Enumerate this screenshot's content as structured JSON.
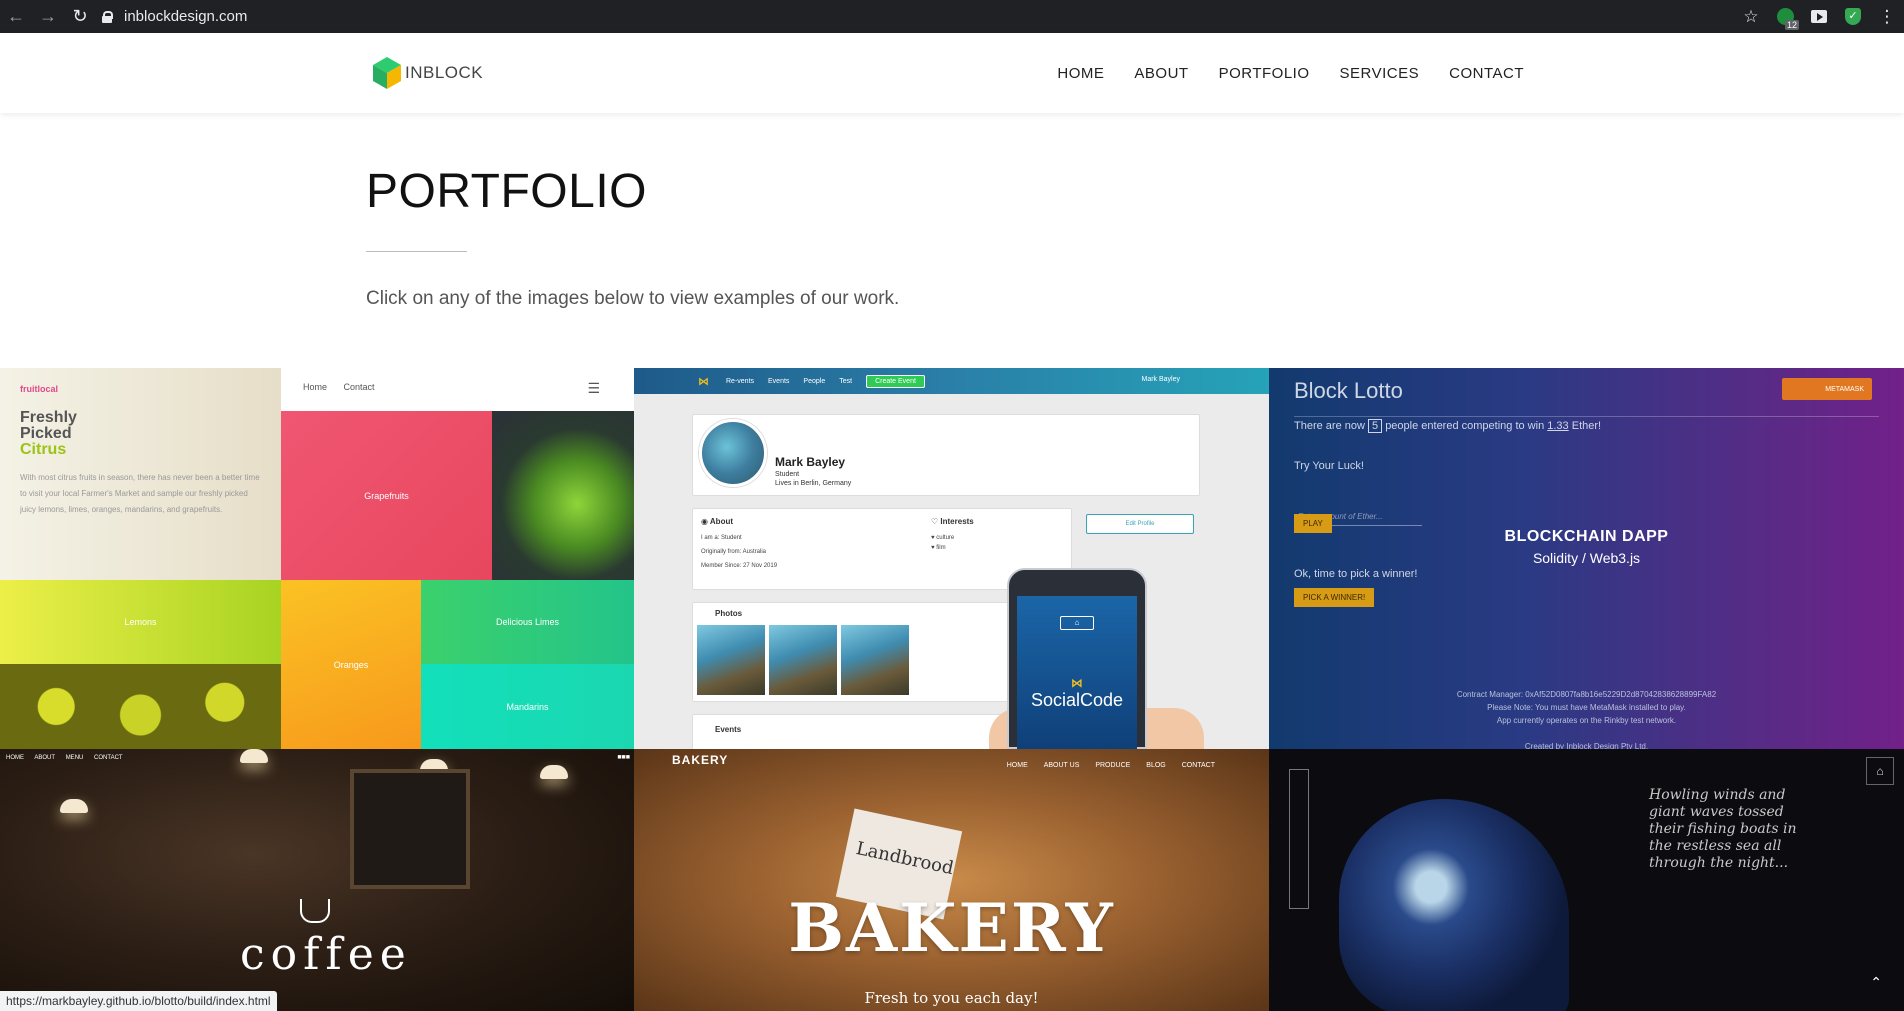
{
  "browser": {
    "url": "inblockdesign.com",
    "extension_badge": "12",
    "status_url": "https://markbayley.github.io/blotto/build/index.html"
  },
  "site": {
    "logo_text": "INBLOCK",
    "nav": [
      "HOME",
      "ABOUT",
      "PORTFOLIO",
      "SERVICES",
      "CONTACT"
    ]
  },
  "page": {
    "title": "PORTFOLIO",
    "intro": "Click on any of the images below to view examples of our work."
  },
  "tiles": {
    "fruit": {
      "brand": "fruitlocal",
      "head1": "Freshly",
      "head2": "Picked",
      "head3": "Citrus",
      "body": "With most citrus fruits in season, there has never been a better time to visit your local Farmer's Market and sample our freshly picked juicy lemons, limes, oranges, mandarins, and grapefruits.",
      "nav": [
        "Home",
        "Contact"
      ],
      "cells": {
        "grapefruits": "Grapefruits",
        "lemons": "Lemons",
        "oranges": "Oranges",
        "limes": "Delicious Limes",
        "mandarins": "Mandarins"
      }
    },
    "social": {
      "nav": [
        "Re-vents",
        "Events",
        "People",
        "Test"
      ],
      "create": "Create Event",
      "user": "Mark Bayley",
      "name": "Mark Bayley",
      "role": "Student",
      "location": "Lives in Berlin, Germany",
      "about": "About",
      "about_rows": [
        "I am a: Student",
        "Originally from: Australia",
        "Member Since: 27 Nov 2019"
      ],
      "interests": "Interests",
      "interest_items": [
        "culture",
        "film"
      ],
      "edit": "Edit Profile",
      "photos": "Photos",
      "events": "Events",
      "app_name": "SocialCode"
    },
    "lotto": {
      "title": "Block Lotto",
      "metamask": "METAMASK",
      "entered_prefix": "There are now",
      "entered_count": "5",
      "entered_mid": "people entered competing to win",
      "prize": "1.33",
      "entered_suffix": "Ether!",
      "try_luck": "Try Your Luck!",
      "input_placeholder": "Enter amount of Ether...",
      "play": "PLAY",
      "pick_prompt": "Ok, time to pick a winner!",
      "pick_button": "PICK A WINNER!",
      "overlay_title": "BLOCKCHAIN DAPP",
      "overlay_sub": "Solidity / Web3.js",
      "contract": "Contract Manager: 0xAf52D0807fa8b16e5229D2d87042838628899FA82",
      "note": "Please Note: You must have MetaMask installed to play.",
      "network": "App currently operates on the Rinkby test network.",
      "credit": "Created by Inblock Design Pty Ltd."
    },
    "coffee": {
      "nav": [
        "HOME",
        "ABOUT",
        "MENU",
        "CONTACT"
      ],
      "word": "coffee"
    },
    "bakery": {
      "logo": "BAKERY",
      "nav": [
        "HOME",
        "ABOUT US",
        "PRODUCE",
        "BLOG",
        "CONTACT"
      ],
      "sign": "Landbrood",
      "word": "BAKERY",
      "tagline": "Fresh to you each day!"
    },
    "wave": {
      "text": "Howling winds and giant waves tossed their fishing boats in the restless sea all through the night..."
    }
  }
}
